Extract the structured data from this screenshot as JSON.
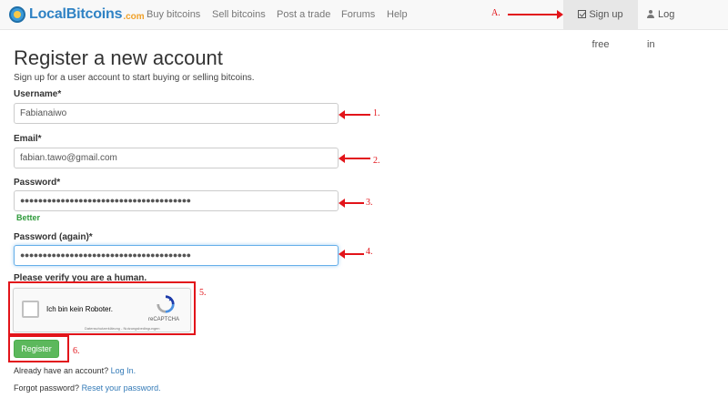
{
  "nav": {
    "brand": "LocalBitcoins",
    "brand_tld": ".com",
    "items": [
      "Buy bitcoins",
      "Sell bitcoins",
      "Post a trade",
      "Forums",
      "Help"
    ],
    "signup": "Sign up free",
    "login": "Log in"
  },
  "form": {
    "title": "Register a new account",
    "subtitle": "Sign up for a user account to start buying or selling bitcoins.",
    "username_label": "Username*",
    "username_value": "Fabianaiwo",
    "email_label": "Email*",
    "email_value": "fabian.tawo@gmail.com",
    "password_label": "Password*",
    "password_value": "●●●●●●●●●●●●●●●●●●●●●●●●●●●●●●●●●●●●●●",
    "password_strength": "Better",
    "password_again_label": "Password (again)*",
    "password_again_value": "●●●●●●●●●●●●●●●●●●●●●●●●●●●●●●●●●●●●●●",
    "verify_label": "Please verify you are a human.",
    "register_button": "Register",
    "have_account_text": "Already have an account?",
    "login_link": "Log In.",
    "forgot_text": "Forgot password?",
    "reset_link": "Reset your password."
  },
  "captcha": {
    "label": "Ich bin kein Roboter.",
    "brand": "reCAPTCHA",
    "legal": "Datenschutzerklärung - Nutzungsbedingungen"
  },
  "annotations": {
    "a": "A.",
    "n1": "1.",
    "n2": "2.",
    "n3": "3.",
    "n4": "4.",
    "n5": "5.",
    "n6": "6."
  },
  "colors": {
    "accent": "#337ab7",
    "success": "#5cb85c",
    "annotation": "#e2141a"
  }
}
